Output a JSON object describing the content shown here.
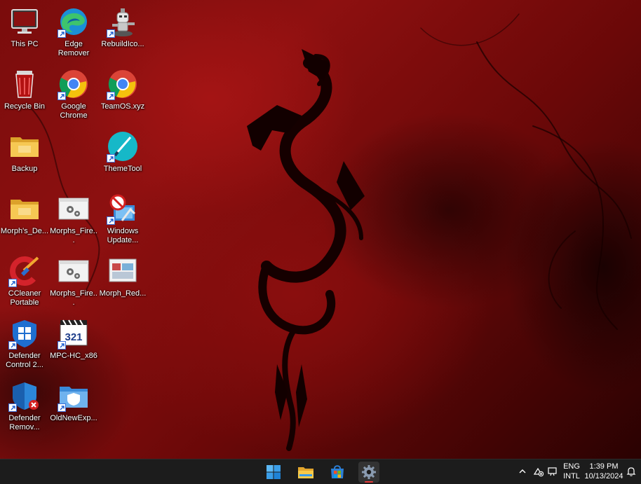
{
  "desktop": {
    "icons": [
      {
        "label": "This PC",
        "icon": "this-pc-icon",
        "shortcut": false
      },
      {
        "label": "Edge Remover",
        "icon": "edge-icon",
        "shortcut": true
      },
      {
        "label": "RebuildIco...",
        "icon": "robot-icon",
        "shortcut": true
      },
      {
        "label": "Recycle Bin",
        "icon": "recycle-bin-icon",
        "shortcut": false
      },
      {
        "label": "Google Chrome",
        "icon": "chrome-icon",
        "shortcut": true
      },
      {
        "label": "TeamOS.xyz",
        "icon": "chrome-icon",
        "shortcut": true
      },
      {
        "label": "Backup",
        "icon": "folder-icon",
        "shortcut": false
      },
      {
        "label": "ThemeTool",
        "icon": "theme-tool-icon",
        "shortcut": true
      },
      {
        "label": "Morph's_De...",
        "icon": "folder-icon",
        "shortcut": false
      },
      {
        "label": "Morphs_Fire...",
        "icon": "settings-file-icon",
        "shortcut": false
      },
      {
        "label": "Windows Update...",
        "icon": "windows-update-blocker-icon",
        "shortcut": true
      },
      {
        "label": "CCleaner Portable",
        "icon": "ccleaner-icon",
        "shortcut": true
      },
      {
        "label": "Morphs_Fire...",
        "icon": "settings-file-icon",
        "shortcut": false
      },
      {
        "label": "Morph_Red...",
        "icon": "registry-file-icon",
        "shortcut": false
      },
      {
        "label": "Defender Control 2...",
        "icon": "defender-control-icon",
        "shortcut": true
      },
      {
        "label": "MPC-HC_x86",
        "icon": "mpc-hc-icon",
        "shortcut": true
      },
      {
        "label": "Defender Remov...",
        "icon": "defender-remover-icon",
        "shortcut": true
      },
      {
        "label": "OldNewExp...",
        "icon": "oldnewexplorer-icon",
        "shortcut": true
      }
    ]
  },
  "taskbar": {
    "buttons": [
      {
        "name": "start-button",
        "icon": "windows-logo-icon"
      },
      {
        "name": "file-explorer-button",
        "icon": "folder-icon"
      },
      {
        "name": "microsoft-store-button",
        "icon": "store-icon"
      },
      {
        "name": "settings-button",
        "icon": "gear-icon",
        "active": true
      }
    ],
    "tray": {
      "language_top": "ENG",
      "language_bottom": "INTL",
      "time": "1:39 PM",
      "date": "10/13/2024"
    }
  }
}
